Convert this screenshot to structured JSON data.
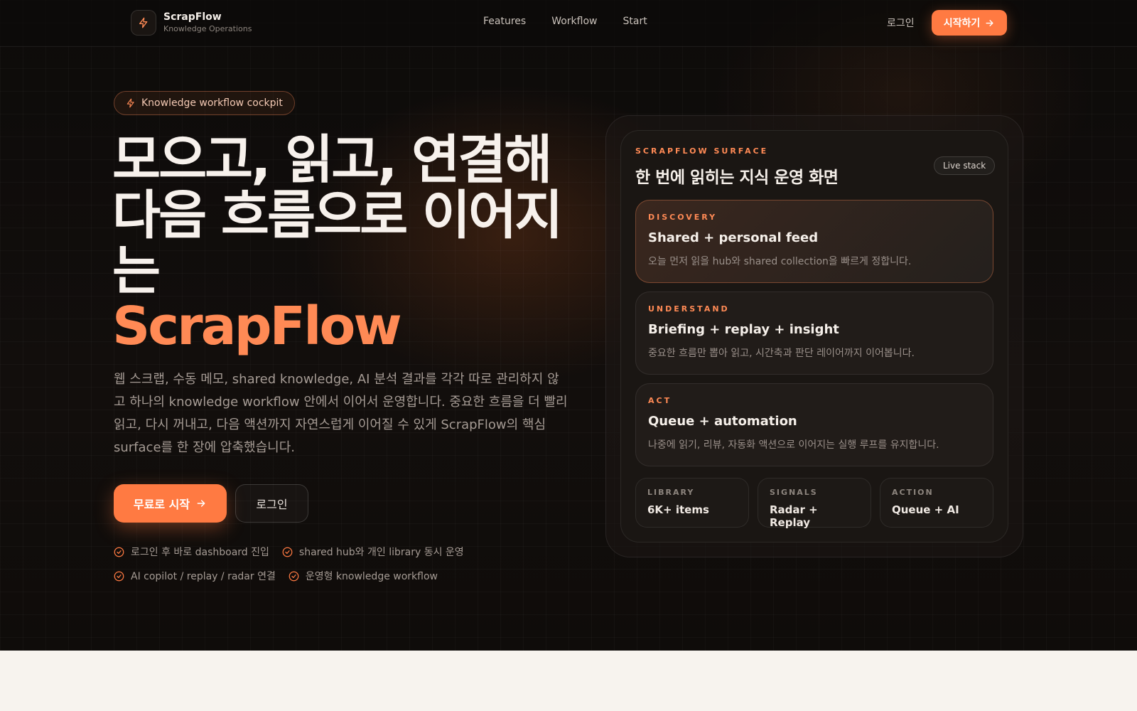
{
  "nav": {
    "brand_name": "ScrapFlow",
    "brand_sub": "Knowledge Operations",
    "links": [
      "Features",
      "Workflow",
      "Start"
    ],
    "login": "로그인",
    "cta": "시작하기"
  },
  "hero": {
    "pill": "Knowledge workflow cockpit",
    "headline_line1": "모으고, 읽고, 연결해",
    "headline_line2": "다음 흐름으로 이어지는",
    "headline_accent": "ScrapFlow",
    "description": "웹 스크랩, 수동 메모, shared knowledge, AI 분석 결과를 각각 따로 관리하지 않고 하나의 knowledge workflow 안에서 이어서 운영합니다. 중요한 흐름을 더 빨리 읽고, 다시 꺼내고, 다음 액션까지 자연스럽게 이어질 수 있게 ScrapFlow의 핵심 surface를 한 장에 압축했습니다.",
    "primary_button": "무료로 시작",
    "secondary_button": "로그인",
    "checks": [
      "로그인 후 바로 dashboard 진입",
      "shared hub와 개인 library 동시 운영",
      "AI copilot / replay / radar 연결",
      "운영형 knowledge workflow"
    ]
  },
  "panel": {
    "kicker": "SCRAPFLOW SURFACE",
    "title": "한 번에 읽히는 지식 운영 화면",
    "badge": "Live stack",
    "cards": [
      {
        "kicker": "DISCOVERY",
        "title": "Shared + personal feed",
        "desc": "오늘 먼저 읽을 hub와 shared collection을 빠르게 정합니다."
      },
      {
        "kicker": "UNDERSTAND",
        "title": "Briefing + replay + insight",
        "desc": "중요한 흐름만 뽑아 읽고, 시간축과 판단 레이어까지 이어봅니다."
      },
      {
        "kicker": "ACT",
        "title": "Queue + automation",
        "desc": "나중에 읽기, 리뷰, 자동화 액션으로 이어지는 실행 루프를 유지합니다."
      }
    ],
    "stats": [
      {
        "label": "LIBRARY",
        "value": "6K+ items"
      },
      {
        "label": "SIGNALS",
        "value": "Radar + Replay"
      },
      {
        "label": "ACTION",
        "value": "Queue + AI"
      }
    ]
  },
  "colors": {
    "accent": "#ff7a42",
    "accent_text": "#ff8a55",
    "background_dark": "#0d0b0a",
    "background_light": "#f7f3ee"
  },
  "icons": {
    "brand": "bolt-icon",
    "pill": "bolt-icon",
    "cta": "arrow-right-icon",
    "check": "check-circle-icon"
  }
}
